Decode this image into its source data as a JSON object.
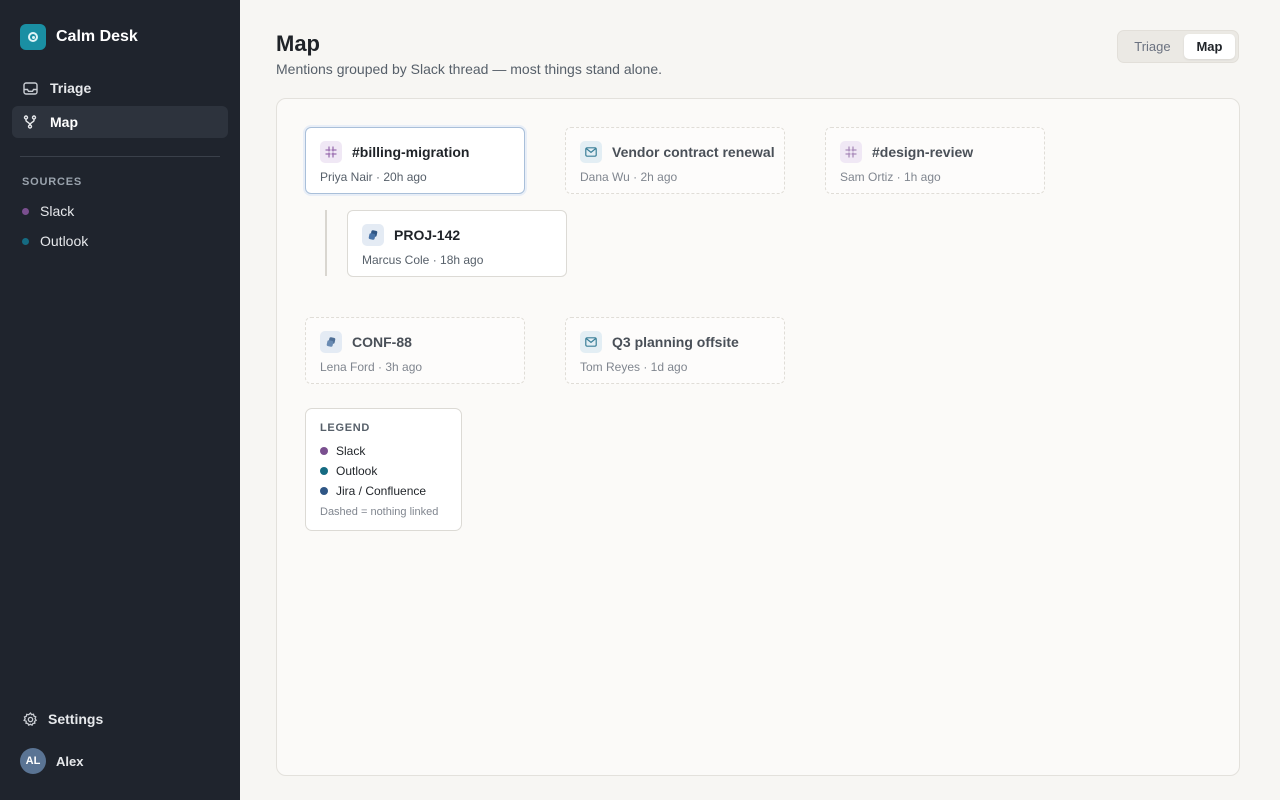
{
  "app": {
    "name": "Calm Desk"
  },
  "nav": {
    "items": [
      {
        "label": "Triage",
        "icon": "inbox-icon",
        "active": false
      },
      {
        "label": "Map",
        "icon": "branch-icon",
        "active": true
      }
    ]
  },
  "sources": {
    "title": "SOURCES",
    "items": [
      {
        "label": "Slack",
        "color": "#7a4f8f"
      },
      {
        "label": "Outlook",
        "color": "#156b82"
      }
    ]
  },
  "settings": {
    "label": "Settings",
    "icon": "gear-icon"
  },
  "user": {
    "initials": "AL",
    "name": "Alex"
  },
  "header": {
    "title": "Map",
    "subtitle": "Mentions grouped by Slack thread — most things stand alone."
  },
  "view_toggle": {
    "options": [
      "Triage",
      "Map"
    ],
    "selected": "Map"
  },
  "cards": [
    {
      "title": "#billing-migration",
      "meta": "Priya Nair · 20h ago",
      "source": "slack",
      "icon": "slack-icon",
      "linked": true,
      "selected": true
    },
    {
      "title": "PROJ-142",
      "meta": "Marcus Cole · 18h ago",
      "source": "jira",
      "icon": "jira-icon",
      "linked": true,
      "selected": false
    },
    {
      "title": "Vendor contract renewal",
      "meta": "Dana Wu · 2h ago",
      "source": "outlook",
      "icon": "mail-icon",
      "linked": false,
      "selected": false
    },
    {
      "title": "#design-review",
      "meta": "Sam Ortiz · 1h ago",
      "source": "slack",
      "icon": "slack-icon",
      "linked": false,
      "selected": false
    },
    {
      "title": "CONF-88",
      "meta": "Lena Ford · 3h ago",
      "source": "jira",
      "icon": "jira-icon",
      "linked": false,
      "selected": false
    },
    {
      "title": "Q3 planning offsite",
      "meta": "Tom Reyes · 1d ago",
      "source": "outlook",
      "icon": "mail-icon",
      "linked": false,
      "selected": false
    }
  ],
  "legend": {
    "title": "LEGEND",
    "items": [
      {
        "label": "Slack",
        "color": "#7a4f8f"
      },
      {
        "label": "Outlook",
        "color": "#156b82"
      },
      {
        "label": "Jira / Confluence",
        "color": "#2f5685"
      }
    ],
    "note": "Dashed = nothing linked"
  },
  "colors": {
    "sidebar_bg": "#1f242d",
    "brand": "#1a8fa3",
    "slack": "#7a4f8f",
    "outlook": "#156b82",
    "jira": "#2f5685"
  }
}
